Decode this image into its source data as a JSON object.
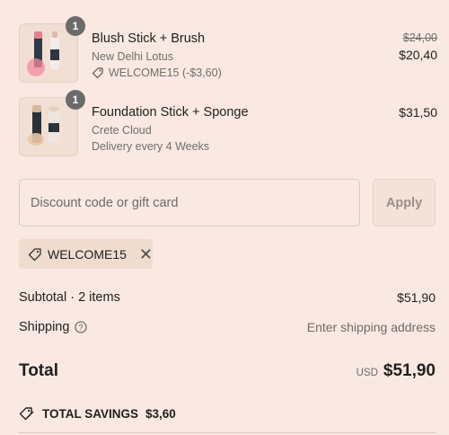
{
  "items": [
    {
      "quantity": "1",
      "name": "Blush Stick + Brush",
      "variant": "New Delhi Lotus",
      "discount": "WELCOME15 (-$3,60)",
      "original_price": "$24,00",
      "price": "$20,40"
    },
    {
      "quantity": "1",
      "name": "Foundation Stick + Sponge",
      "variant": "Crete Cloud",
      "delivery": "Delivery every 4 Weeks",
      "price": "$31,50"
    }
  ],
  "discount_form": {
    "placeholder": "Discount code or gift card",
    "apply_label": "Apply"
  },
  "applied_code": "WELCOME15",
  "summary": {
    "subtotal_label": "Subtotal · 2 items",
    "subtotal_value": "$51,90",
    "shipping_label": "Shipping",
    "shipping_value": "Enter shipping address",
    "total_label": "Total",
    "currency": "USD",
    "total_value": "$51,90",
    "savings_label": "TOTAL SAVINGS",
    "savings_value": "$3,60"
  },
  "icons": [
    "tag-icon",
    "help-circle-icon",
    "close-icon",
    "savings-tag-icon"
  ]
}
